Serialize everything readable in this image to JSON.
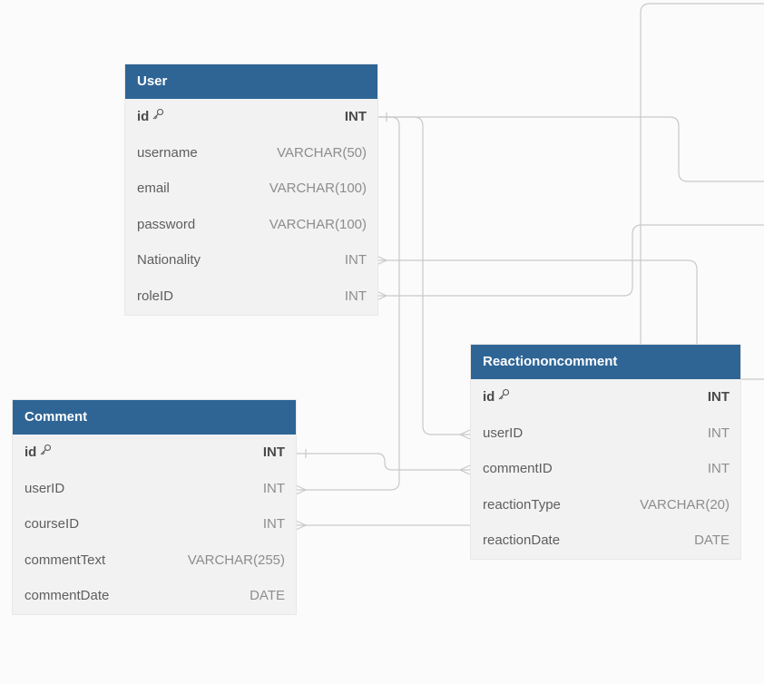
{
  "tables": {
    "user": {
      "title": "User",
      "rows": [
        {
          "name": "id",
          "type": "INT",
          "pk": true
        },
        {
          "name": "username",
          "type": "VARCHAR(50)"
        },
        {
          "name": "email",
          "type": "VARCHAR(100)"
        },
        {
          "name": "password",
          "type": "VARCHAR(100)"
        },
        {
          "name": "Nationality",
          "type": "INT"
        },
        {
          "name": "roleID",
          "type": "INT"
        }
      ]
    },
    "reaction": {
      "title": "Reactiononcomment",
      "rows": [
        {
          "name": "id",
          "type": "INT",
          "pk": true
        },
        {
          "name": "userID",
          "type": "INT"
        },
        {
          "name": "commentID",
          "type": "INT"
        },
        {
          "name": "reactionType",
          "type": "VARCHAR(20)"
        },
        {
          "name": "reactionDate",
          "type": "DATE"
        }
      ]
    },
    "comment": {
      "title": "Comment",
      "rows": [
        {
          "name": "id",
          "type": "INT",
          "pk": true
        },
        {
          "name": "userID",
          "type": "INT"
        },
        {
          "name": "courseID",
          "type": "INT"
        },
        {
          "name": "commentText",
          "type": "VARCHAR(255)"
        },
        {
          "name": "commentDate",
          "type": "DATE"
        }
      ]
    }
  },
  "icons": {
    "primary_key": "key-icon"
  },
  "colors": {
    "header": "#2f6595",
    "edge": "#c9c9c9"
  }
}
